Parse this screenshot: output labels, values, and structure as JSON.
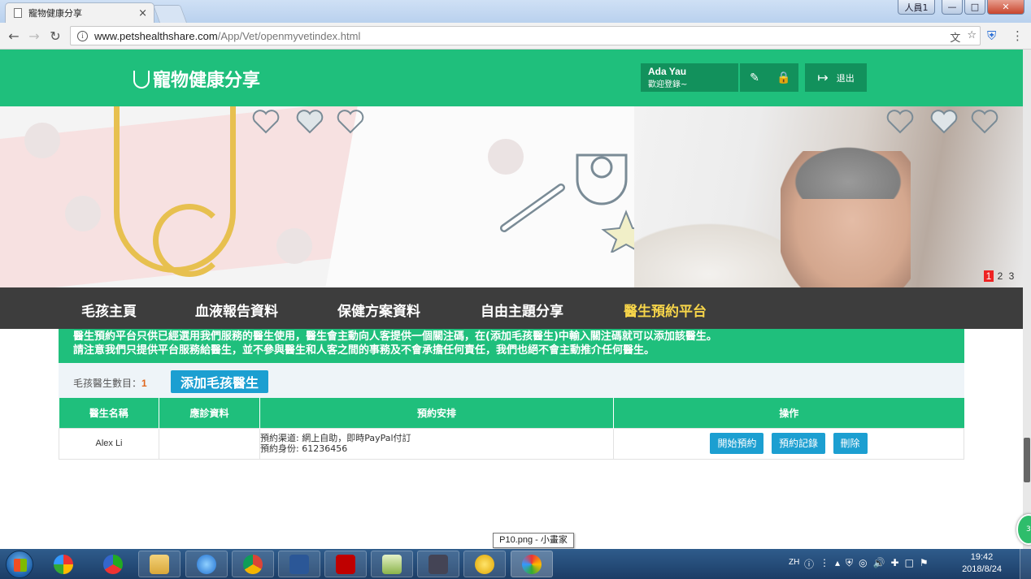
{
  "browser": {
    "tab_title": "寵物健康分享",
    "tab_close": "×",
    "user_button": "人員1",
    "url_host": "www.petshealthshare.com",
    "url_path": "/App/Vet/openmyvetindex.html"
  },
  "header": {
    "logo_text": "寵物健康分享",
    "user_name": "Ada Yau",
    "welcome": "歡迎登錄~",
    "logout_label": "退出"
  },
  "banner": {
    "pages": [
      "1",
      "2",
      "3"
    ],
    "active_page": "1"
  },
  "nav": {
    "items": [
      {
        "label": "毛孩主頁"
      },
      {
        "label": "血液報告資料"
      },
      {
        "label": "保健方案資料"
      },
      {
        "label": "自由主題分享"
      },
      {
        "label": "醫生預約平台"
      }
    ],
    "active_index": 4
  },
  "notice": {
    "line1": "醫生預約平台只供已經選用我們服務的醫生使用，醫生會主動向人客提供一個關注碼，在(添加毛孩醫生)中輸入關注碼就可以添加該醫生。",
    "line2": "請注意我們只提供平台服務給醫生，並不參與醫生和人客之間的事務及不會承擔任何責任，我們也絕不會主動推介任何醫生。"
  },
  "vets": {
    "count_label": "毛孩醫生數目：",
    "count": "1",
    "add_button": "添加毛孩醫生",
    "columns": [
      "醫生名稱",
      "應診資料",
      "預約安排",
      "操作"
    ],
    "rows": [
      {
        "name": "Alex Li",
        "clinic": "",
        "channel": "預約渠道: 網上自助，即時PayPal付訂",
        "identity": "預約身份: 61236456",
        "actions": [
          "開始預約",
          "預約記錄",
          "刪除"
        ]
      }
    ]
  },
  "tooltip": "P10.png - 小畫家",
  "float_badge": "38",
  "taskbar": {
    "lang": "ZH",
    "time": "19:42",
    "date": "2018/8/24"
  },
  "colors": {
    "brand_green": "#1fbf7c",
    "dark_green": "#12915c",
    "button_blue": "#1c9fd1",
    "nav_dark": "#3d3d3d",
    "nav_active": "#f7d54a",
    "count_orange": "#e0671d"
  }
}
